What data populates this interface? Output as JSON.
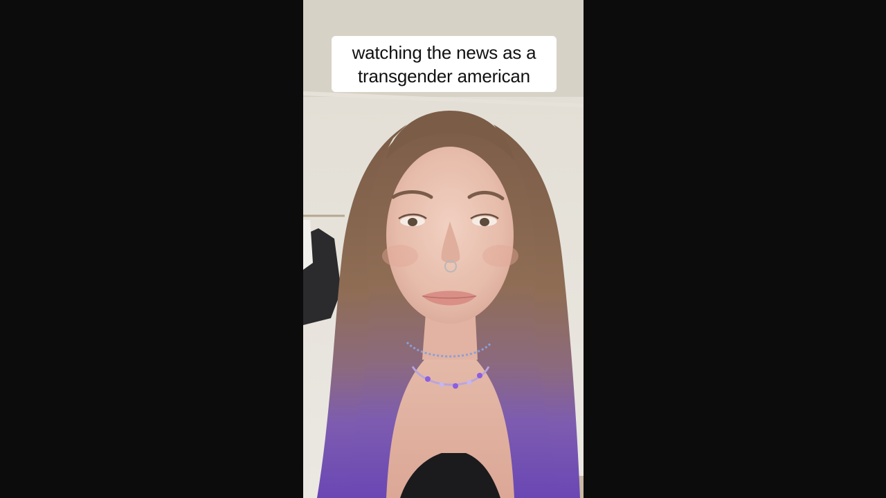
{
  "caption": {
    "line1": "watching the news as a",
    "line2": "transgender american"
  },
  "colors": {
    "letterbox": "#0c0c0c",
    "caption_bg": "#ffffff",
    "caption_text": "#111111",
    "wall": "#e8e5de",
    "ceiling": "#d9d4c9",
    "hair_brown": "#8a6a52",
    "hair_purple": "#7a58b8",
    "skin": "#e9c2b2",
    "shirt": "#1a1a1a"
  }
}
